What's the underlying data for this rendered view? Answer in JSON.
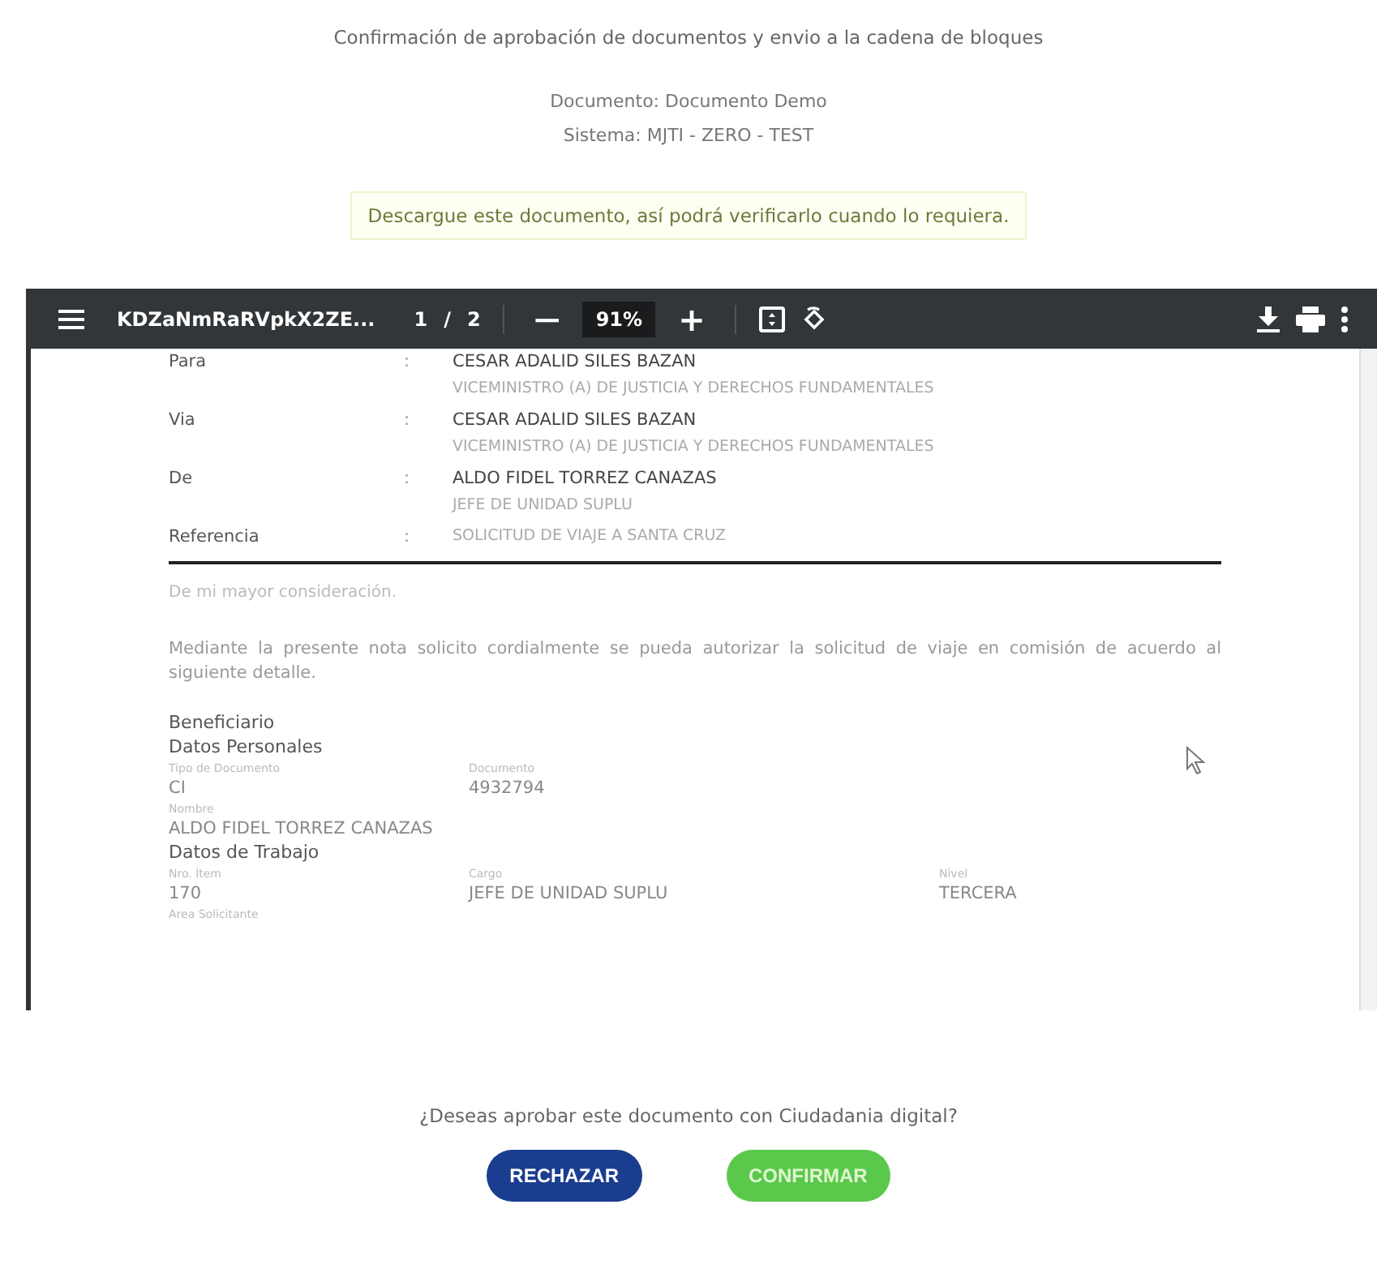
{
  "heading": "Confirmación de aprobación de documentos y envio a la cadena de bloques",
  "document_line": "Documento: Documento Demo",
  "system_line": "Sistema: MJTI - ZERO - TEST",
  "notice": "Descargue este documento, así podrá verificarlo cuando lo requiera.",
  "viewer": {
    "file_name": "KDZaNmRaRVpkX2ZE...",
    "page": "1",
    "page_separator": "/",
    "page_count": "2",
    "zoom_out": "—",
    "zoom": "91%",
    "zoom_in": "+"
  },
  "letter_fields": [
    {
      "label": "Para",
      "separator": ":",
      "name": "CESAR ADALID SILES BAZAN",
      "role": "VICEMINISTRO (A) DE JUSTICIA Y DERECHOS FUNDAMENTALES"
    },
    {
      "label": "Via",
      "separator": ":",
      "name": "CESAR ADALID SILES BAZAN",
      "role": "VICEMINISTRO (A) DE JUSTICIA Y DERECHOS FUNDAMENTALES"
    },
    {
      "label": "De",
      "separator": ":",
      "name": "ALDO FIDEL TORREZ CANAZAS",
      "role": "JEFE DE UNIDAD SUPLU"
    },
    {
      "label": "Referencia",
      "separator": ":",
      "name": "SOLICITUD DE VIAJE A SANTA CRUZ"
    }
  ],
  "greeting": "De mi mayor consideración.",
  "body": "Mediante la presente nota solicito cordialmente se pueda autorizar la solicitud de viaje en comisión de acuerdo al siguiente detalle.",
  "beneficiary_heading": "Beneficiario",
  "sections": [
    {
      "title": "Datos Personales",
      "rows": [
        [
          {
            "label": "Tipo de Documento",
            "value": "CI"
          },
          {
            "label": "Documento",
            "value": "4932794"
          }
        ],
        [
          {
            "label": "Nombre",
            "value": "ALDO FIDEL TORREZ CANAZAS"
          }
        ]
      ]
    },
    {
      "title": "Datos de Trabajo",
      "rows": [
        [
          {
            "label": "Nro. Item",
            "value": "170"
          },
          {
            "label": "Cargo",
            "value": "JEFE DE UNIDAD SUPLU"
          },
          {
            "label": "Nivel",
            "value": "TERCERA"
          }
        ],
        [
          {
            "label": "Area Solicitante"
          }
        ]
      ]
    }
  ],
  "question": "¿Deseas aprobar este documento con Ciudadania digital?",
  "buttons": [
    {
      "label": "RECHAZAR",
      "kind": "reject"
    },
    {
      "label": "CONFIRMAR",
      "kind": "confirm"
    }
  ]
}
